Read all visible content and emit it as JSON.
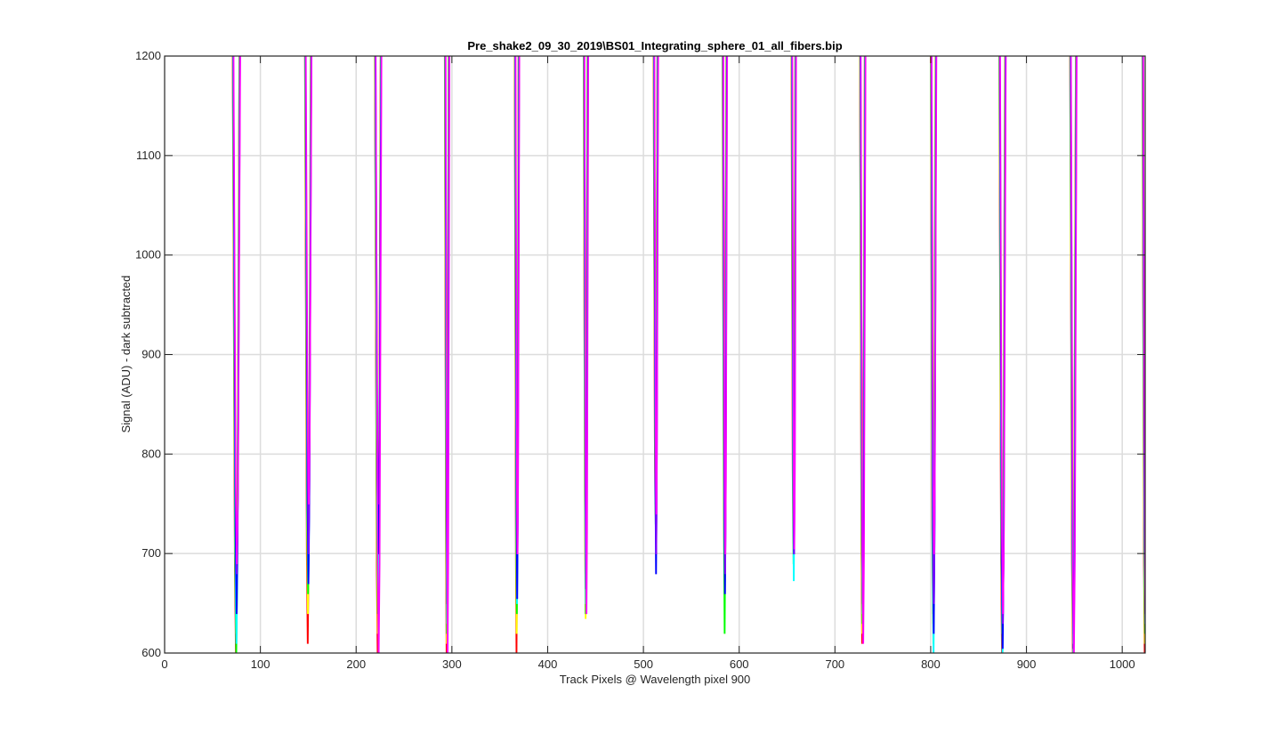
{
  "chart_data": {
    "type": "line",
    "title": "Pre_shake2_09_30_2019\\BS01_Integrating_sphere_01_all_fibers.bip",
    "xlabel": "Track Pixels @ Wavelength pixel 900",
    "ylabel": "Signal (ADU) - dark subtracted",
    "xlim": [
      0,
      1024
    ],
    "ylim": [
      600,
      1200
    ],
    "xticks": [
      0,
      100,
      200,
      300,
      400,
      500,
      600,
      700,
      800,
      900,
      1000
    ],
    "yticks": [
      600,
      700,
      800,
      900,
      1000,
      1100,
      1200
    ],
    "grid": true,
    "legend": "none",
    "series_colors": [
      "#ff0000",
      "#ffff00",
      "#00ff00",
      "#00ffff",
      "#0000ff",
      "#8000ff",
      "#ff00ff"
    ],
    "valleys": [
      {
        "center": 75,
        "width": 7,
        "mins": [
          600,
          620,
          600,
          610,
          640,
          680,
          690
        ]
      },
      {
        "center": 150,
        "width": 6,
        "mins": [
          610,
          640,
          660,
          670,
          670,
          700,
          750
        ]
      },
      {
        "center": 223,
        "width": 6,
        "mins": [
          600,
          620,
          640,
          660,
          700,
          750,
          600
        ]
      },
      {
        "center": 295,
        "width": 4,
        "mins": [
          600,
          610,
          620,
          630,
          650,
          700,
          600
        ]
      },
      {
        "center": 368,
        "width": 4,
        "mins": [
          600,
          620,
          640,
          650,
          655,
          700,
          700
        ]
      },
      {
        "center": 440,
        "width": 4,
        "mins": [
          680,
          635,
          640,
          650,
          665,
          700,
          640
        ]
      },
      {
        "center": 513,
        "width": 4,
        "mins": [
          750,
          740,
          730,
          720,
          680,
          700,
          740
        ]
      },
      {
        "center": 585,
        "width": 4,
        "mins": [
          700,
          680,
          620,
          680,
          660,
          680,
          700
        ]
      },
      {
        "center": 657,
        "width": 4,
        "mins": [
          710,
          700,
          690,
          673,
          700,
          700,
          705
        ]
      },
      {
        "center": 729,
        "width": 5,
        "mins": [
          610,
          620,
          630,
          640,
          650,
          640,
          610
        ]
      },
      {
        "center": 803,
        "width": 5,
        "mins": [
          640,
          630,
          610,
          600,
          620,
          650,
          700
        ]
      },
      {
        "center": 875,
        "width": 6,
        "mins": [
          600,
          620,
          610,
          600,
          605,
          630,
          640
        ]
      },
      {
        "center": 949,
        "width": 6,
        "mins": [
          600,
          610,
          620,
          600,
          605,
          610,
          600
        ]
      },
      {
        "center": 1024,
        "width": 5,
        "mins": [
          600,
          610,
          620,
          630,
          640,
          650,
          600
        ]
      }
    ]
  }
}
